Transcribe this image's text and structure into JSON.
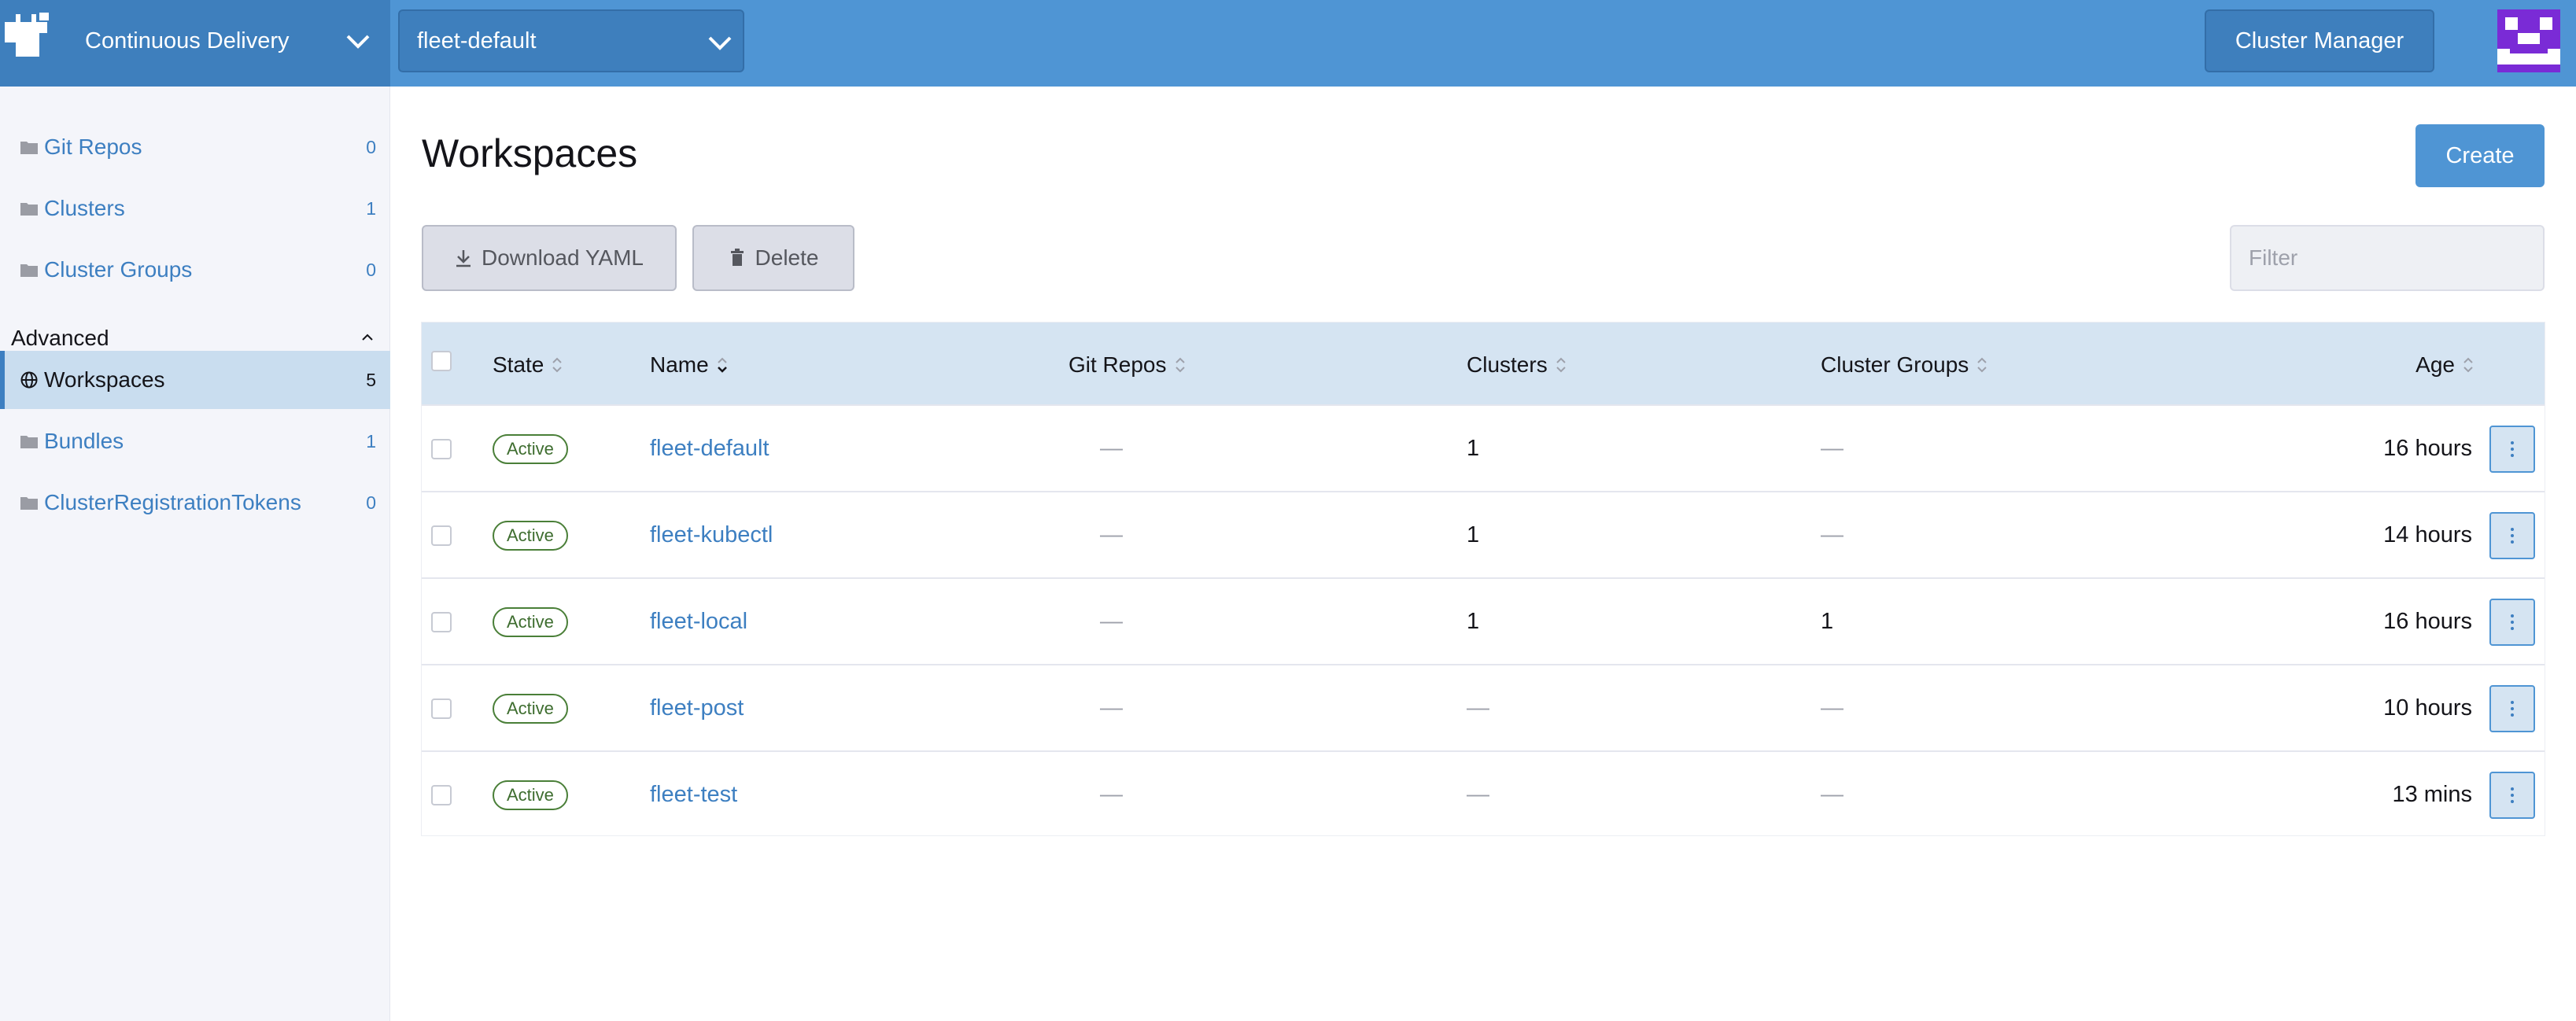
{
  "header": {
    "product": "Continuous Delivery",
    "workspace_selected": "fleet-default",
    "cluster_manager_label": "Cluster Manager"
  },
  "sidebar": {
    "items": [
      {
        "label": "Git Repos",
        "count": "0"
      },
      {
        "label": "Clusters",
        "count": "1"
      },
      {
        "label": "Cluster Groups",
        "count": "0"
      }
    ],
    "group_label": "Advanced",
    "advanced_items": [
      {
        "label": "Workspaces",
        "count": "5",
        "active": true
      },
      {
        "label": "Bundles",
        "count": "1"
      },
      {
        "label": "ClusterRegistrationTokens",
        "count": "0"
      }
    ]
  },
  "main": {
    "title": "Workspaces",
    "create_label": "Create",
    "download_label": "Download YAML",
    "delete_label": "Delete",
    "filter_placeholder": "Filter"
  },
  "table": {
    "columns": [
      "State",
      "Name",
      "Git Repos",
      "Clusters",
      "Cluster Groups",
      "Age"
    ],
    "rows": [
      {
        "state": "Active",
        "name": "fleet-default",
        "git_repos": "—",
        "clusters": "1",
        "cluster_groups": "—",
        "age": "16 hours"
      },
      {
        "state": "Active",
        "name": "fleet-kubectl",
        "git_repos": "—",
        "clusters": "1",
        "cluster_groups": "—",
        "age": "14 hours"
      },
      {
        "state": "Active",
        "name": "fleet-local",
        "git_repos": "—",
        "clusters": "1",
        "cluster_groups": "1",
        "age": "16 hours"
      },
      {
        "state": "Active",
        "name": "fleet-post",
        "git_repos": "—",
        "clusters": "—",
        "cluster_groups": "—",
        "age": "10 hours"
      },
      {
        "state": "Active",
        "name": "fleet-test",
        "git_repos": "—",
        "clusters": "—",
        "cluster_groups": "—",
        "age": "13 mins"
      }
    ]
  },
  "colors": {
    "header": "#4f95d4",
    "header_dark": "#3e7fbd",
    "link": "#3d7fc1",
    "active_badge": "#4a7f38",
    "avatar": "#7a2bd6"
  }
}
